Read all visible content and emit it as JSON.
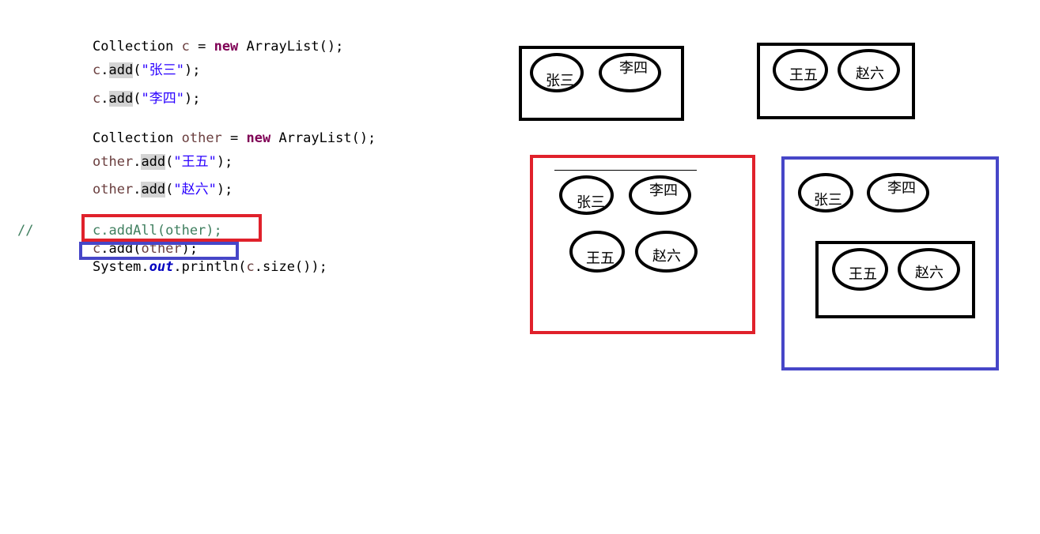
{
  "code": {
    "line1": {
      "type": "Collection",
      "var": "c",
      "op": " = ",
      "kw": "new",
      "cls": " ArrayList();"
    },
    "line2": {
      "obj": "c",
      "method": "add",
      "open": "(",
      "str": "\"张三\"",
      "close": ");"
    },
    "line3": {
      "obj": "c",
      "method": "add",
      "open": "(",
      "str": "\"李四\"",
      "close": ");"
    },
    "line4": {
      "type": "Collection",
      "var": "other",
      "op": " = ",
      "kw": "new",
      "cls": " ArrayList();"
    },
    "line5": {
      "obj": "other",
      "method": "add",
      "open": "(",
      "str": "\"王五\"",
      "close": ");"
    },
    "line6": {
      "obj": "other",
      "method": "add",
      "open": "(",
      "str": "\"赵六\"",
      "close": ");"
    },
    "comment_marker": "//",
    "line7": "c.addAll(other);",
    "line8": {
      "obj": "c",
      "method": "add",
      "open": "(",
      "arg": "other",
      "close": ");"
    },
    "line9": {
      "cls": "System.",
      "field": "out",
      "rest": ".println(",
      "obj": "c",
      "tail": ".size());"
    }
  },
  "diagram": {
    "names": {
      "zhang": "张三",
      "li": "李四",
      "wang": "王五",
      "zhao": "赵六"
    }
  },
  "colors": {
    "keyword": "#7f0055",
    "variable": "#6a3e3e",
    "string": "#2a00ff",
    "comment": "#3f7f5f",
    "red_box": "#e0212b",
    "blue_box": "#4646c8",
    "black_box": "#000000"
  }
}
